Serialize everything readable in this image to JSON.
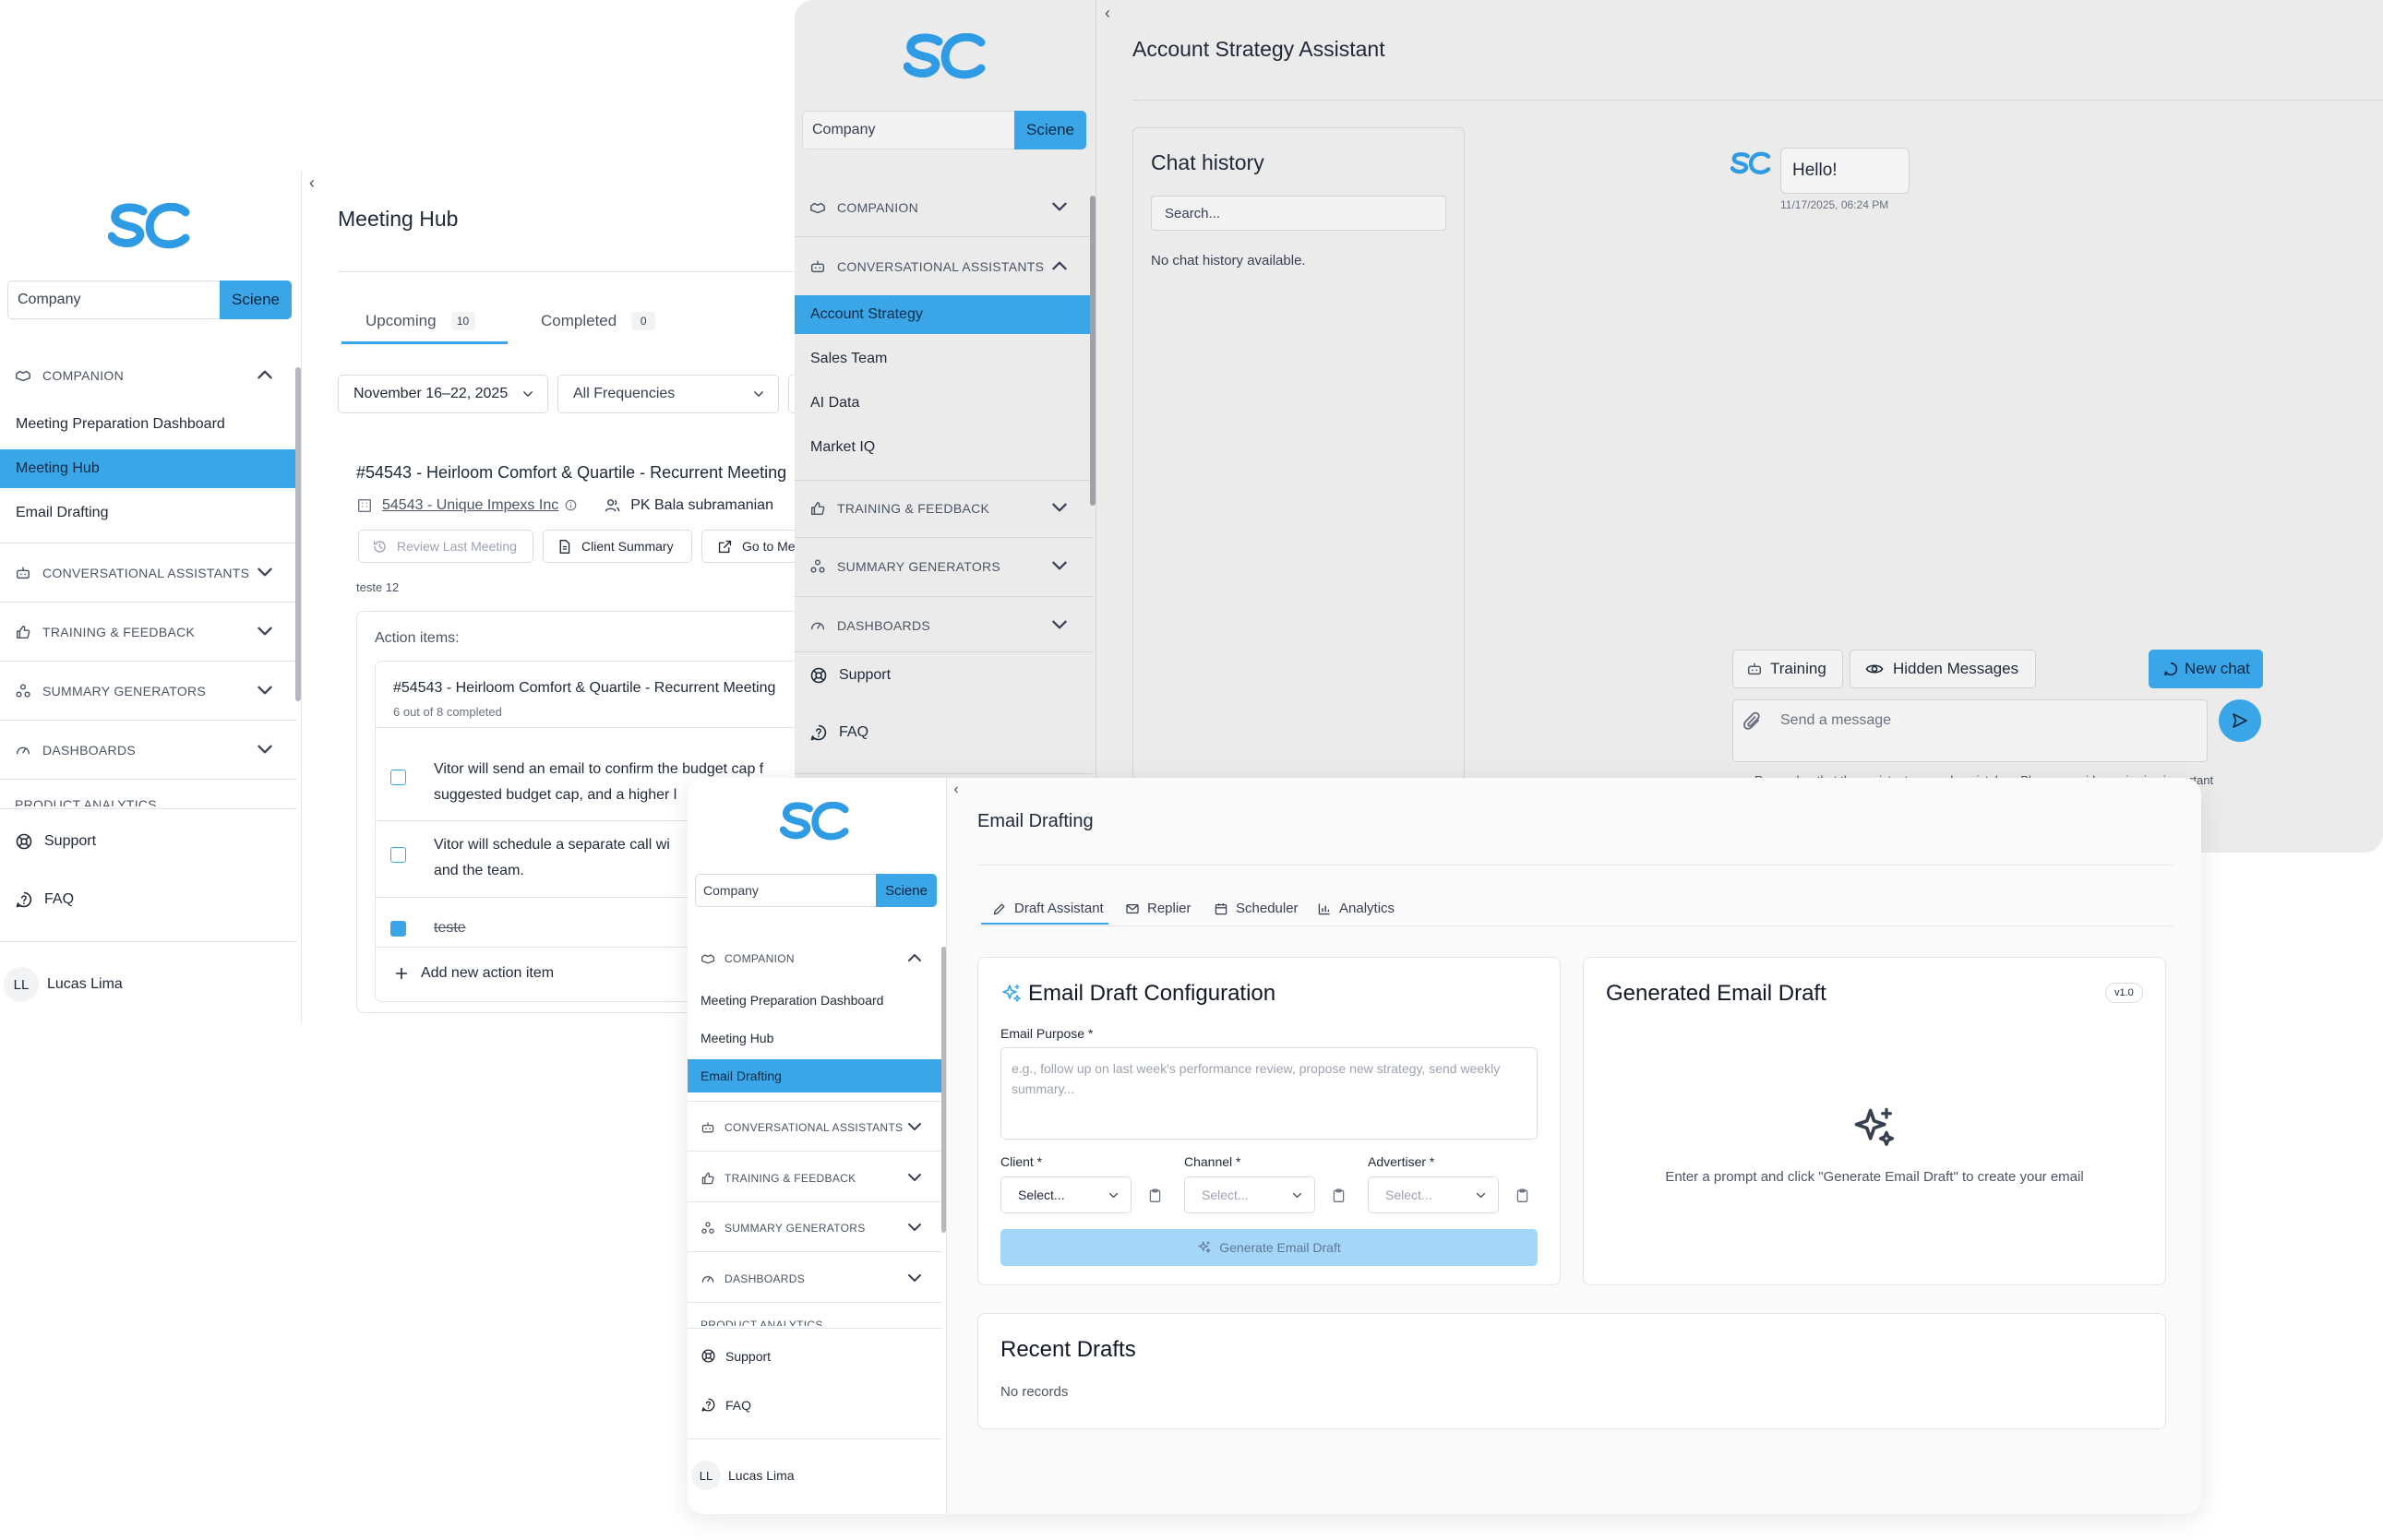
{
  "brand": {
    "accent": "#3aa6e8",
    "logo_color": "#2f9be4"
  },
  "sidebar": {
    "search_placeholder": "Company",
    "search_button": "Sciene",
    "companion": "COMPANION",
    "companion_items": [
      "Meeting Preparation Dashboard",
      "Meeting Hub",
      "Email Drafting"
    ],
    "conversational_assistants": "CONVERSATIONAL ASSISTANTS",
    "assistant_items": [
      "Account Strategy",
      "Sales Team",
      "AI Data",
      "Market IQ"
    ],
    "training_feedback": "TRAINING & FEEDBACK",
    "summary_generators": "SUMMARY GENERATORS",
    "dashboards": "DASHBOARDS",
    "product_analytics": "PRODUCT ANALYTICS",
    "support": "Support",
    "faq": "FAQ",
    "user_initials": "LL",
    "user_name": "Lucas Lima"
  },
  "meeting_hub": {
    "title": "Meeting Hub",
    "tabs": [
      {
        "label": "Upcoming",
        "count": "10"
      },
      {
        "label": "Completed",
        "count": "0"
      }
    ],
    "date_range": "November 16–22, 2025",
    "frequency": "All Frequencies",
    "meeting_title": "#54543 - Heirloom Comfort & Quartile - Recurrent Meeting",
    "company_link": "54543 - Unique Impexs Inc",
    "owner": "PK Bala subramanian",
    "btn_review": "Review Last Meeting",
    "btn_summary": "Client Summary",
    "btn_goto": "Go to Meeting",
    "note": "teste 12",
    "action_items_label": "Action items:",
    "group_title": "#54543 - Heirloom Comfort & Quartile - Recurrent Meeting",
    "group_progress": "6 out of 8 completed",
    "items": [
      {
        "line1": "Vitor will send an email to confirm the budget cap f",
        "line2": "suggested budget cap, and a higher l",
        "done": false
      },
      {
        "line1": "Vitor will schedule a separate call wi",
        "line2": "and the team.",
        "done": false
      },
      {
        "line1": "teste",
        "line2": "",
        "done": true
      }
    ],
    "add_item": "Add new action item"
  },
  "account_strategy": {
    "title": "Account Strategy Assistant",
    "chat_history_title": "Chat history",
    "search_placeholder": "Search...",
    "empty": "No chat history available.",
    "message": "Hello!",
    "message_time": "11/17/2025, 06:24 PM",
    "btn_training": "Training",
    "btn_hidden": "Hidden Messages",
    "btn_new_chat": "New chat",
    "input_placeholder": "Send a message",
    "disclaimer": "Remember that the assistant can make mistakes. Please consider reviewing important"
  },
  "email_drafting": {
    "title": "Email Drafting",
    "tabs": [
      "Draft Assistant",
      "Replier",
      "Scheduler",
      "Analytics"
    ],
    "config_title": "Email Draft Configuration",
    "purpose_label": "Email Purpose *",
    "purpose_placeholder_1": "e.g., follow up on last week's performance review, propose new strategy, send weekly",
    "purpose_placeholder_2": "summary...",
    "client_label": "Client *",
    "channel_label": "Channel *",
    "advertiser_label": "Advertiser *",
    "select_placeholder": "Select...",
    "generate_button": "Generate Email Draft",
    "generated_title": "Generated Email Draft",
    "version": "v1.0",
    "generated_hint": "Enter a prompt and click \"Generate Email Draft\" to create your email",
    "recent_title": "Recent Drafts",
    "recent_empty": "No records"
  }
}
